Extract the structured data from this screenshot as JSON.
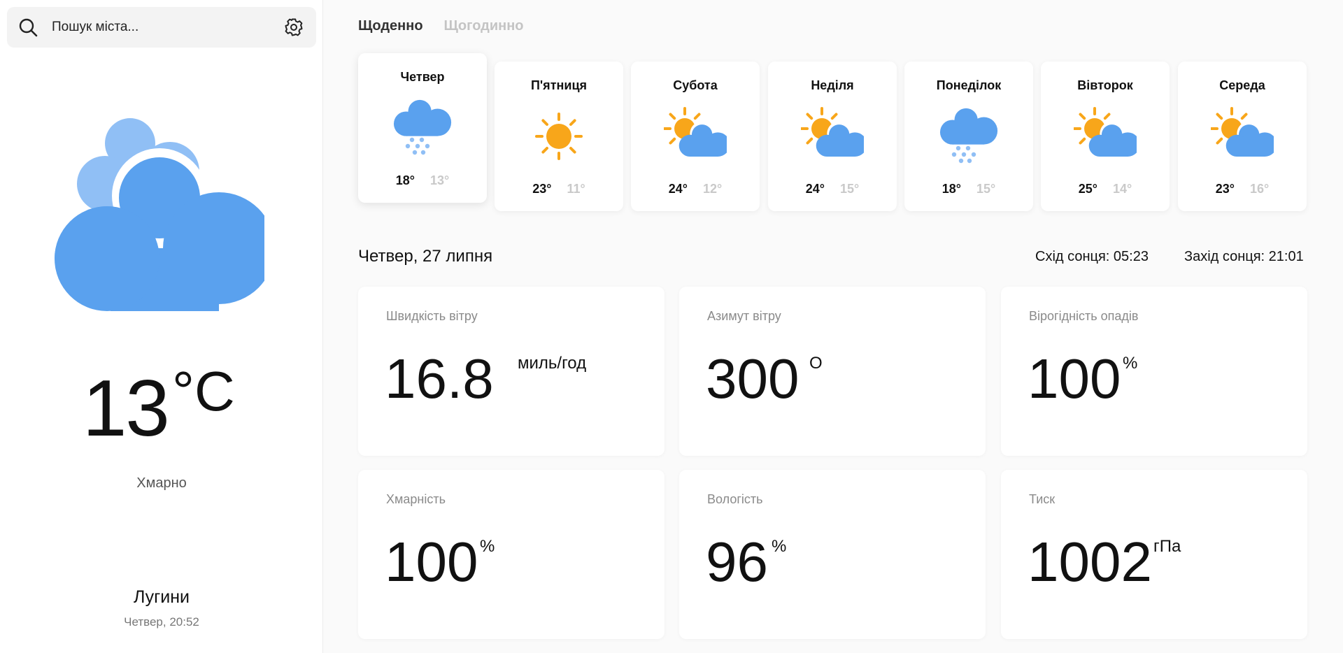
{
  "search": {
    "placeholder": "Пошук міста..."
  },
  "current": {
    "temp": "13",
    "unit": "°C",
    "condition": "Хмарно",
    "city": "Лугини",
    "datetime": "Четвер, 20:52",
    "icon": "cloudy-icon"
  },
  "tabs": [
    {
      "label": "Щоденно",
      "active": true
    },
    {
      "label": "Щогодинно",
      "active": false
    }
  ],
  "days": [
    {
      "name": "Четвер",
      "hi": "18°",
      "lo": "13°",
      "icon": "snow-icon"
    },
    {
      "name": "П'ятниця",
      "hi": "23°",
      "lo": "11°",
      "icon": "sun-icon"
    },
    {
      "name": "Субота",
      "hi": "24°",
      "lo": "12°",
      "icon": "partly-cloudy-icon"
    },
    {
      "name": "Неділя",
      "hi": "24°",
      "lo": "15°",
      "icon": "partly-cloudy-icon"
    },
    {
      "name": "Понеділок",
      "hi": "18°",
      "lo": "15°",
      "icon": "snow-icon"
    },
    {
      "name": "Вівторок",
      "hi": "25°",
      "lo": "14°",
      "icon": "partly-cloudy-icon"
    },
    {
      "name": "Середа",
      "hi": "23°",
      "lo": "16°",
      "icon": "partly-cloudy-icon"
    }
  ],
  "selected_date": "Четвер, 27 липня",
  "sunrise": "Схід сонця: 05:23",
  "sunset": "Захід сонця: 21:01",
  "stats": [
    {
      "label": "Швидкість вітру",
      "value": "16.8",
      "unit": "миль/год"
    },
    {
      "label": "Азимут вітру",
      "value": "300",
      "unit": "O"
    },
    {
      "label": "Вірогідність опадів",
      "value": "100",
      "unit": "%"
    },
    {
      "label": "Хмарність",
      "value": "100",
      "unit": "%"
    },
    {
      "label": "Вологість",
      "value": "96",
      "unit": "%"
    },
    {
      "label": "Тиск",
      "value": "1002",
      "unit": "гПа"
    }
  ],
  "colors": {
    "cloud": "#5aa1ee",
    "cloud_light": "#90bff5",
    "sun": "#f8a61a",
    "snow": "#90bff5"
  }
}
